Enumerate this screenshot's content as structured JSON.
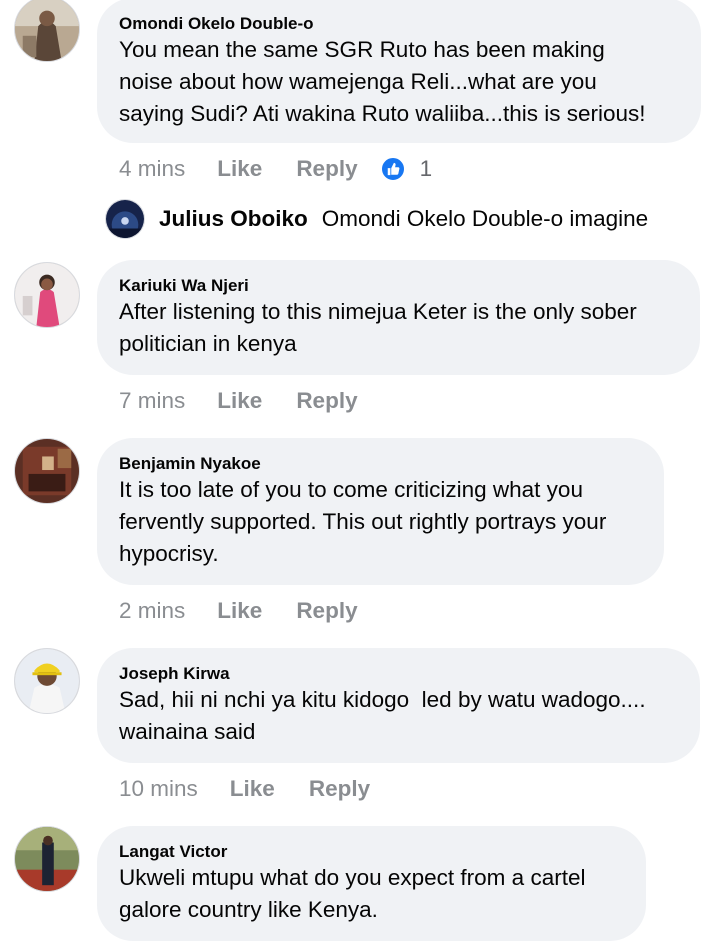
{
  "comments": [
    {
      "author": "Omondi Okelo Double-o",
      "text": "You mean the same SGR Ruto has been making\nnoise about how wamejenga Reli...what are you\nsaying Sudi? Ati wakina Ruto waliiba...this is serious!",
      "time": "4 mins",
      "like_label": "Like",
      "reply_label": "Reply",
      "reaction_count": "1",
      "reaction_icon": "thumbs-up-icon"
    },
    {
      "author": "Kariuki Wa Njeri",
      "text": "After listening to this nimejua Keter is the only sober\npolitician in kenya",
      "time": "7 mins",
      "like_label": "Like",
      "reply_label": "Reply"
    },
    {
      "author": "Benjamin Nyakoe",
      "text": "It is too late of you to come criticizing what you\nfervently supported. This out rightly portrays your\nhypocrisy.",
      "time": "2 mins",
      "like_label": "Like",
      "reply_label": "Reply"
    },
    {
      "author": "Joseph Kirwa",
      "text": "Sad, hii ni nchi ya kitu kidogo  led by watu wadogo....\nwainaina said",
      "time": "10 mins",
      "like_label": "Like",
      "reply_label": "Reply"
    },
    {
      "author": "Langat Victor",
      "text": "Ukweli mtupu what do you expect from a cartel\ngalore country like Kenya."
    }
  ],
  "reply_preview": {
    "author": "Julius Oboiko",
    "text": "Omondi Okelo Double-o imagine"
  },
  "colors": {
    "bubble": "#f0f2f5",
    "meta_text": "#8a8d91",
    "like_blue": "#1877f2"
  }
}
